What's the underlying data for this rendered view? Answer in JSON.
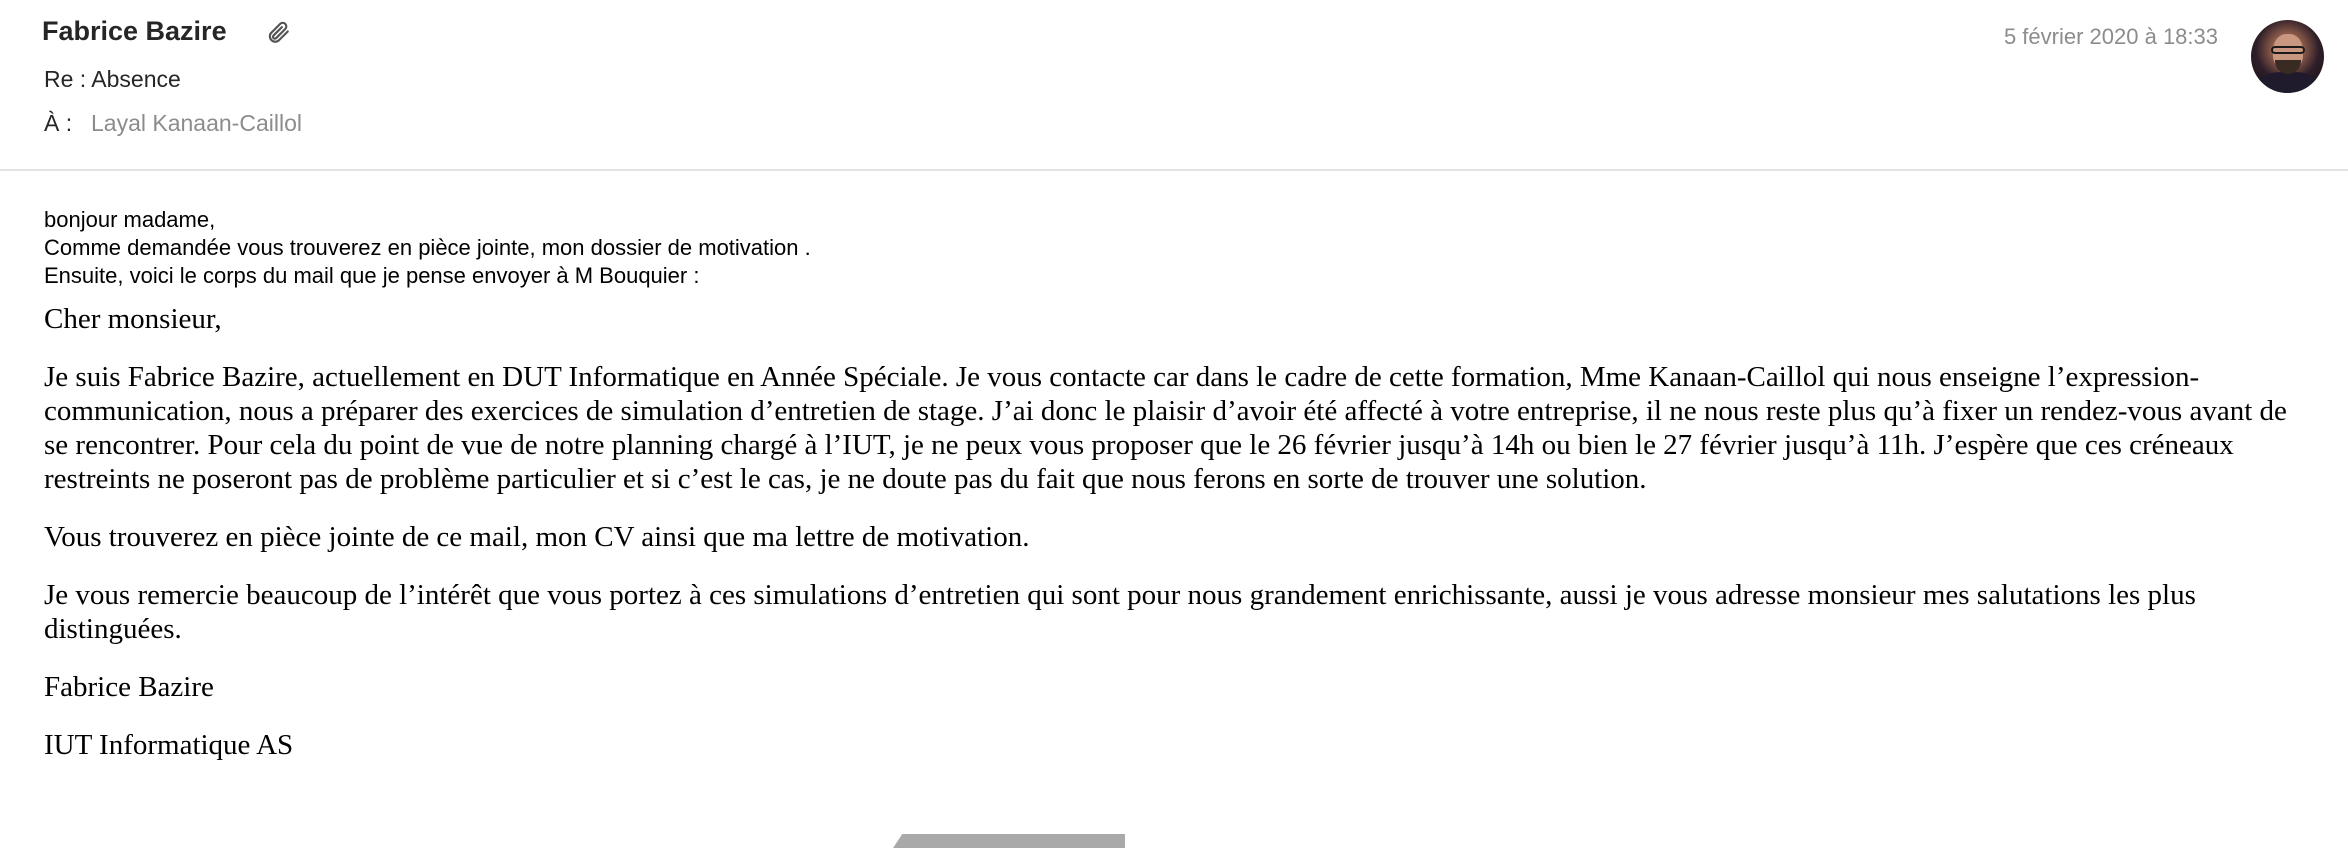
{
  "header": {
    "sender": "Fabrice Bazire",
    "subject": "Re : Absence",
    "to_label": "À :",
    "to_value": "Layal Kanaan-Caillol",
    "date": "5 février 2020 à 18:33",
    "attachment_icon": "paperclip-icon"
  },
  "body": {
    "intro": [
      "bonjour madame,",
      "Comme demandée vous trouverez en pièce jointe, mon dossier de motivation .",
      "Ensuite, voici le corps du mail que je pense envoyer à M Bouquier :"
    ],
    "letter": [
      "Cher monsieur,",
      "Je suis Fabrice Bazire, actuellement en DUT Informatique en Année Spéciale. Je vous contacte car dans le cadre de cette formation, Mme Kanaan-Caillol qui nous enseigne l’expression-communication, nous a préparer des exercices de simulation d’entretien de stage. J’ai donc le plaisir d’avoir été affecté à votre entreprise, il ne nous reste plus qu’à fixer un rendez-vous avant de se rencontrer. Pour cela du point de vue de notre planning chargé à l’IUT, je ne peux vous proposer que le 26 février jusqu’à 14h ou bien le 27 février jusqu’à 11h. J’espère que ces créneaux restreints ne poseront pas de problème particulier et si c’est le cas, je ne doute pas du fait que nous ferons en sorte de trouver une solution.",
      "Vous trouverez en pièce jointe de ce mail, mon CV ainsi que ma lettre de motivation.",
      "Je vous remercie beaucoup de l’intérêt que vous portez à ces simulations d’entretien qui sont pour nous grandement enrichissante, aussi je vous adresse monsieur mes salutations les plus distinguées.",
      "Fabrice Bazire",
      "IUT Informatique AS"
    ]
  }
}
